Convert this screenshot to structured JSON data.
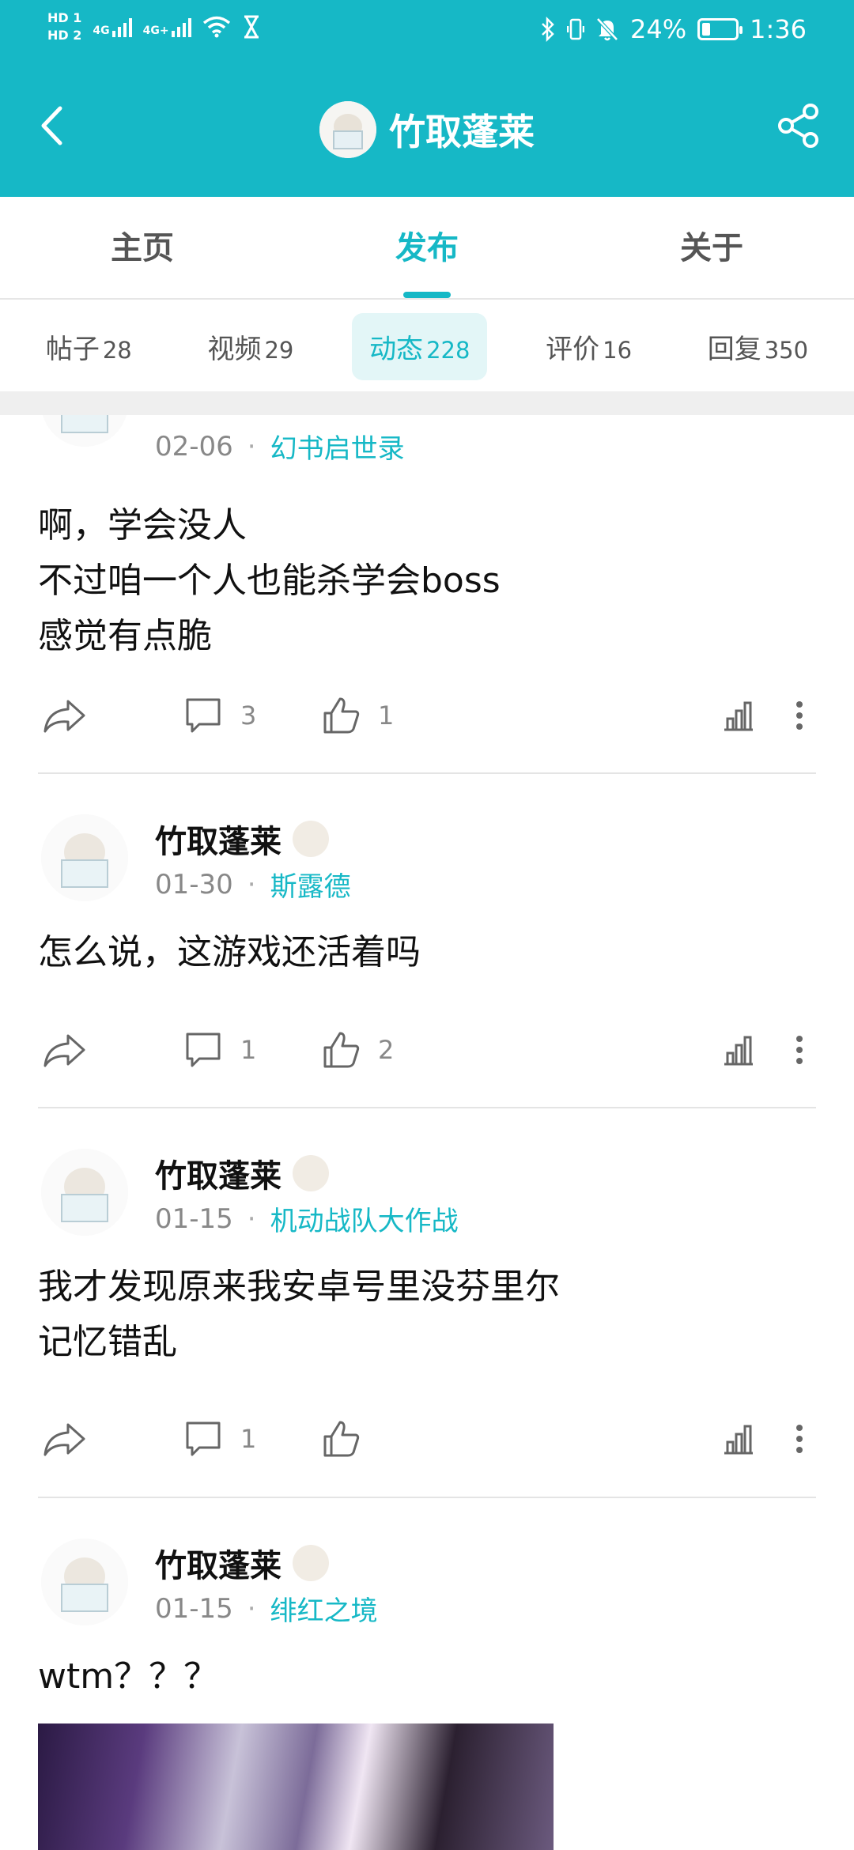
{
  "status_bar": {
    "hd1": "HD 1",
    "hd2": "HD 2",
    "net1": "4G",
    "net2": "4G+",
    "battery_text": "24%",
    "battery_level": 0.24,
    "time": "1:36"
  },
  "header": {
    "title": "竹取蓬莱"
  },
  "main_tabs": [
    {
      "label": "主页"
    },
    {
      "label": "发布"
    },
    {
      "label": "关于"
    }
  ],
  "sub_tabs": [
    {
      "label": "帖子",
      "count": "28"
    },
    {
      "label": "视频",
      "count": "29"
    },
    {
      "label": "动态",
      "count": "228"
    },
    {
      "label": "评价",
      "count": "16"
    },
    {
      "label": "回复",
      "count": "350"
    }
  ],
  "posts": [
    {
      "author": "",
      "date": "02-06",
      "game": "幻书启世录",
      "lines": [
        "啊，学会没人",
        "不过咱一个人也能杀学会boss",
        "感觉有点脆"
      ],
      "comments": "3",
      "likes": "1"
    },
    {
      "author": "竹取蓬莱",
      "date": "01-30",
      "game": "斯露德",
      "lines": [
        "怎么说，这游戏还活着吗"
      ],
      "comments": "1",
      "likes": "2"
    },
    {
      "author": "竹取蓬莱",
      "date": "01-15",
      "game": "机动战队大作战",
      "lines": [
        "我才发现原来我安卓号里没芬里尔",
        "记忆错乱"
      ],
      "comments": "1",
      "likes": ""
    },
    {
      "author": "竹取蓬莱",
      "date": "01-15",
      "game": "绯红之境",
      "lines": [
        "wtm？？？"
      ],
      "comments": "",
      "likes": ""
    }
  ],
  "colors": {
    "accent": "#16b8c6",
    "text": "#111111",
    "muted": "#888888"
  },
  "icons": [
    "back-arrow-icon",
    "share-icon",
    "bluetooth-icon",
    "vibrate-icon",
    "bell-off-icon",
    "wifi-icon",
    "hourglass-icon",
    "forward-icon",
    "comment-icon",
    "thumbs-up-icon",
    "stats-icon",
    "more-icon"
  ]
}
